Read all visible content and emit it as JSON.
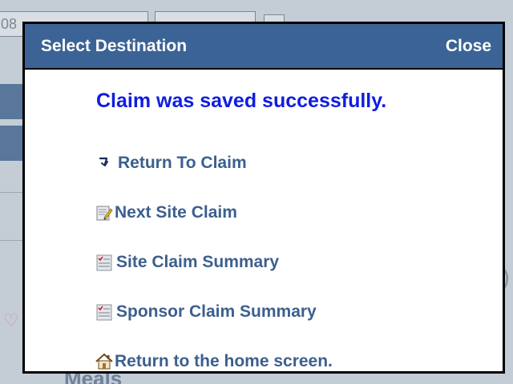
{
  "dialog": {
    "title": "Select Destination",
    "close_label": "Close",
    "message": "Claim was saved successfully.",
    "items": [
      {
        "label": "Return To Claim",
        "icon": "return-arrow-icon"
      },
      {
        "label": "Next Site Claim",
        "icon": "edit-document-icon"
      },
      {
        "label": "Site Claim Summary",
        "icon": "checklist-icon"
      },
      {
        "label": "Sponsor Claim Summary",
        "icon": "checklist-icon"
      },
      {
        "label": "Return to the home screen.",
        "icon": "home-icon"
      }
    ]
  },
  "background": {
    "partial_text_left": "08",
    "partial_text_bottom": "Meals"
  },
  "colors": {
    "header_bg": "#3b6395",
    "message": "#0f1de0",
    "link": "#3c5f8e"
  }
}
